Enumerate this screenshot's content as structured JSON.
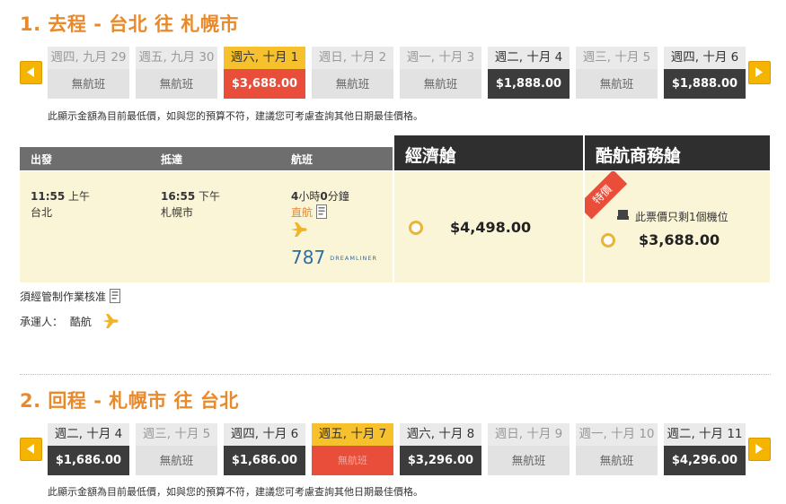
{
  "outbound": {
    "title": "1. 去程 - 台北 往 札幌市",
    "days": [
      {
        "date": "週四, 九月 29",
        "price": "無航班",
        "state": "none"
      },
      {
        "date": "週五, 九月 30",
        "price": "無航班",
        "state": "none"
      },
      {
        "date": "週六, 十月 1",
        "price": "$3,688.00",
        "state": "selected"
      },
      {
        "date": "週日, 十月 2",
        "price": "無航班",
        "state": "none"
      },
      {
        "date": "週一, 十月 3",
        "price": "無航班",
        "state": "none"
      },
      {
        "date": "週二, 十月 4",
        "price": "$1,888.00",
        "state": "available"
      },
      {
        "date": "週三, 十月 5",
        "price": "無航班",
        "state": "none"
      },
      {
        "date": "週四, 十月 6",
        "price": "$1,888.00",
        "state": "available"
      }
    ],
    "note": "此顯示金額為目前最低價，如與您的預算不符，建議您可考慮查詢其他日期最佳價格。"
  },
  "table": {
    "col_depart": "出發",
    "col_arrive": "抵達",
    "col_flight": "航班",
    "economy_label": "經濟艙",
    "business_label": "酷航商務艙",
    "depart_time": "11:55",
    "depart_ampm": "上午",
    "depart_city": "台北",
    "arrive_time": "16:55",
    "arrive_ampm": "下午",
    "arrive_city": "札幌市",
    "duration_h": "4",
    "duration_h_unit": "小時",
    "duration_m": "0",
    "duration_m_unit": "分鐘",
    "direct": "直航",
    "aircraft_num": "787",
    "aircraft_brand": "DREAMLINER",
    "economy_price": "$4,498.00",
    "promo_badge": "特價",
    "seats_left": "此票價只剩1個機位",
    "business_price": "$3,688.00"
  },
  "footnotes": {
    "approval": "須經管制作業核准",
    "carrier_label": "承運人：",
    "carrier_name": "酷航"
  },
  "return": {
    "title": "2. 回程 - 札幌市 往 台北",
    "days": [
      {
        "date": "週二, 十月 4",
        "price": "$1,686.00",
        "state": "available"
      },
      {
        "date": "週三, 十月 5",
        "price": "無航班",
        "state": "none"
      },
      {
        "date": "週四, 十月 6",
        "price": "$1,686.00",
        "state": "available"
      },
      {
        "date": "週五, 十月 7",
        "price": "無航班",
        "state": "selected-none"
      },
      {
        "date": "週六, 十月 8",
        "price": "$3,296.00",
        "state": "available"
      },
      {
        "date": "週日, 十月 9",
        "price": "無航班",
        "state": "none"
      },
      {
        "date": "週一, 十月 10",
        "price": "無航班",
        "state": "none"
      },
      {
        "date": "週二, 十月 11",
        "price": "$4,296.00",
        "state": "available"
      }
    ],
    "note": "此顯示金額為目前最低價，如與您的預算不符，建議您可考慮查詢其他日期最佳價格。"
  },
  "icons": {
    "prev": "chevron-left-icon",
    "next": "chevron-right-icon",
    "info": "document-icon",
    "plane": "plane-icon",
    "seat": "seat-icon"
  },
  "colors": {
    "accent": "#e8892b",
    "selected_date": "#f6c12c",
    "selected_price": "#e94e3a",
    "available_price": "#3c3c3c",
    "panel": "#fbf5d8",
    "cabin_header": "#2f2f2f"
  }
}
